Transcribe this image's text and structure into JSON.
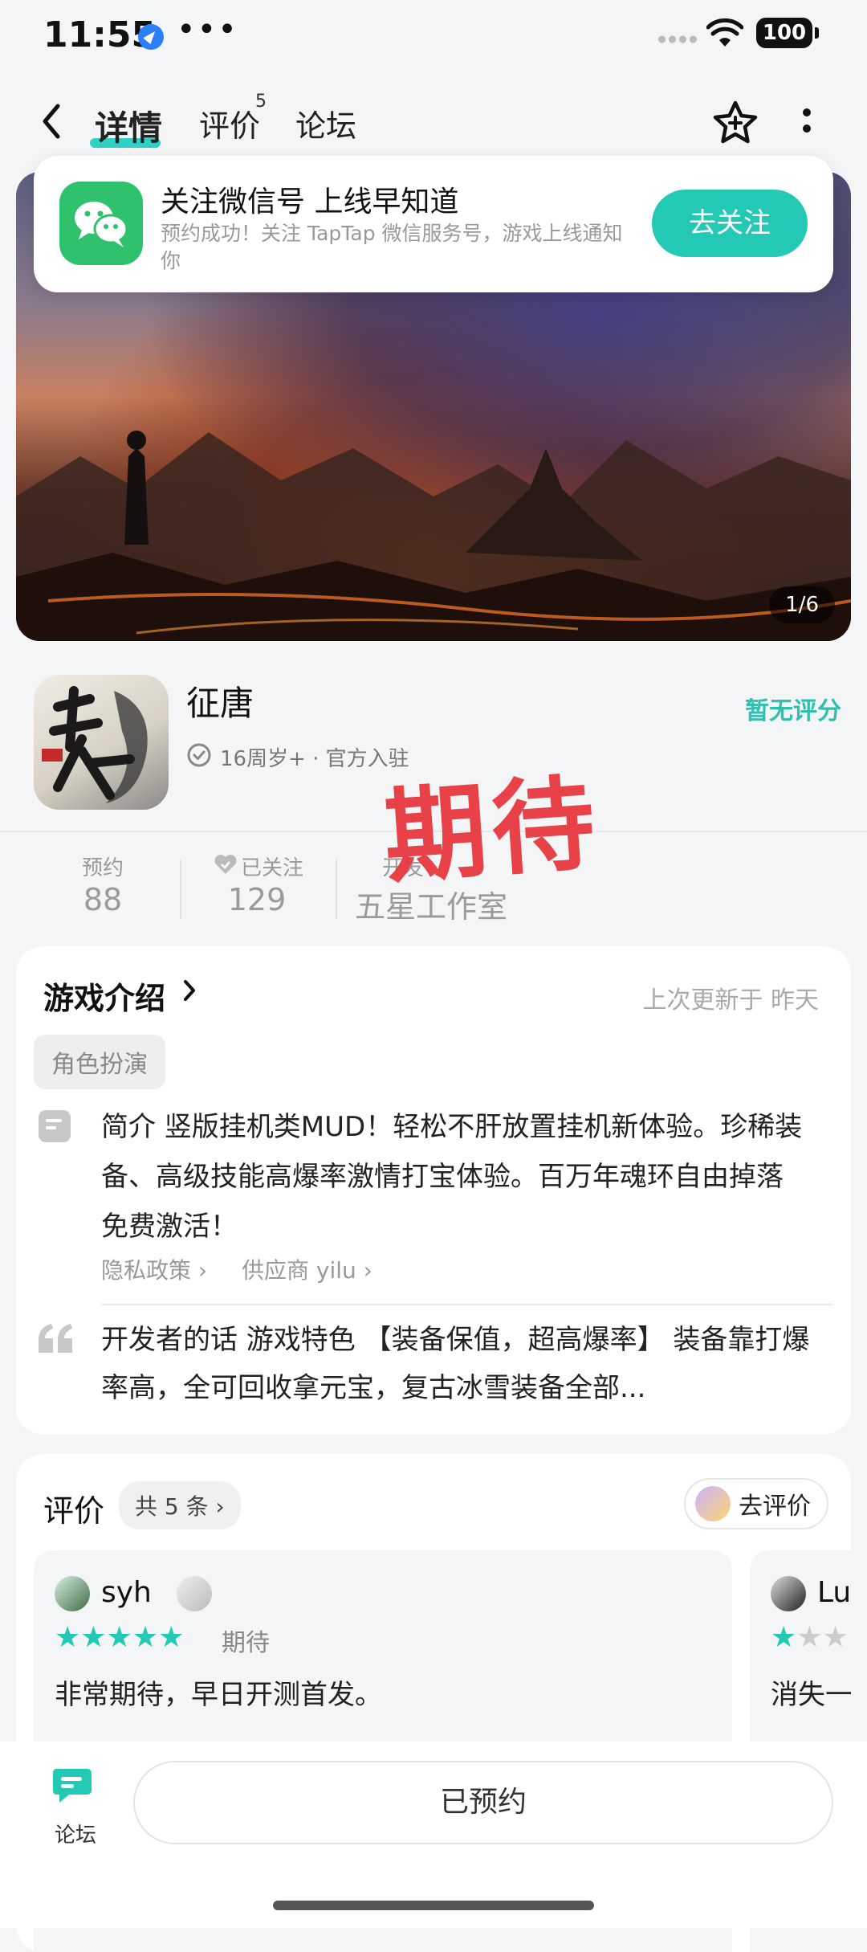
{
  "status_bar": {
    "time": "11:55",
    "dots": "•••",
    "battery": "100"
  },
  "nav": {
    "tabs": [
      {
        "label": "详情"
      },
      {
        "label": "评价",
        "count": "5"
      },
      {
        "label": "论坛"
      }
    ]
  },
  "notification": {
    "title": "关注微信号 上线早知道",
    "desc": "预约成功！关注 TapTap 微信服务号，游戏上线通知你",
    "button": "去关注"
  },
  "banner": {
    "counter": "1/6"
  },
  "app": {
    "name": "征唐",
    "meta": "16周岁+ · 官方入驻",
    "rating": "暂无评分",
    "stamp": "期待"
  },
  "stats": [
    {
      "label": "预约",
      "value": "88"
    },
    {
      "label": "已关注",
      "value": "129"
    },
    {
      "label": "开发",
      "value": "五星工作室"
    }
  ],
  "intro": {
    "title": "游戏介绍",
    "updated": "上次更新于 昨天",
    "tag": "角色扮演",
    "text": "简介 竖版挂机类MUD！轻松不肝放置挂机新体验。珍稀装备、高级技能高爆率激情打宝体验。百万年魂环自由掉落免费激活！",
    "privacy_link": "隐私政策",
    "supplier_link": "供应商 yilu",
    "dev_text": "开发者的话 游戏特色 【装备保值，超高爆率】 装备靠打爆率高，全可回收拿元宝，复古冰雪装备全部..."
  },
  "reviews": {
    "title": "评价",
    "count": "共 5 条",
    "write_button": "去评价",
    "items": [
      {
        "user": "syh",
        "stars": 5,
        "label": "期待",
        "text": "非常期待，早日开测首发。"
      },
      {
        "user": "Lu",
        "stars": 1,
        "label": "",
        "text": "消失一"
      }
    ]
  },
  "bottom": {
    "forum_label": "论坛",
    "reserve_button": "已预约"
  },
  "colors": {
    "accent": "#2ed1c3",
    "stamp": "#e8333a",
    "wechat": "#2fc16b"
  }
}
